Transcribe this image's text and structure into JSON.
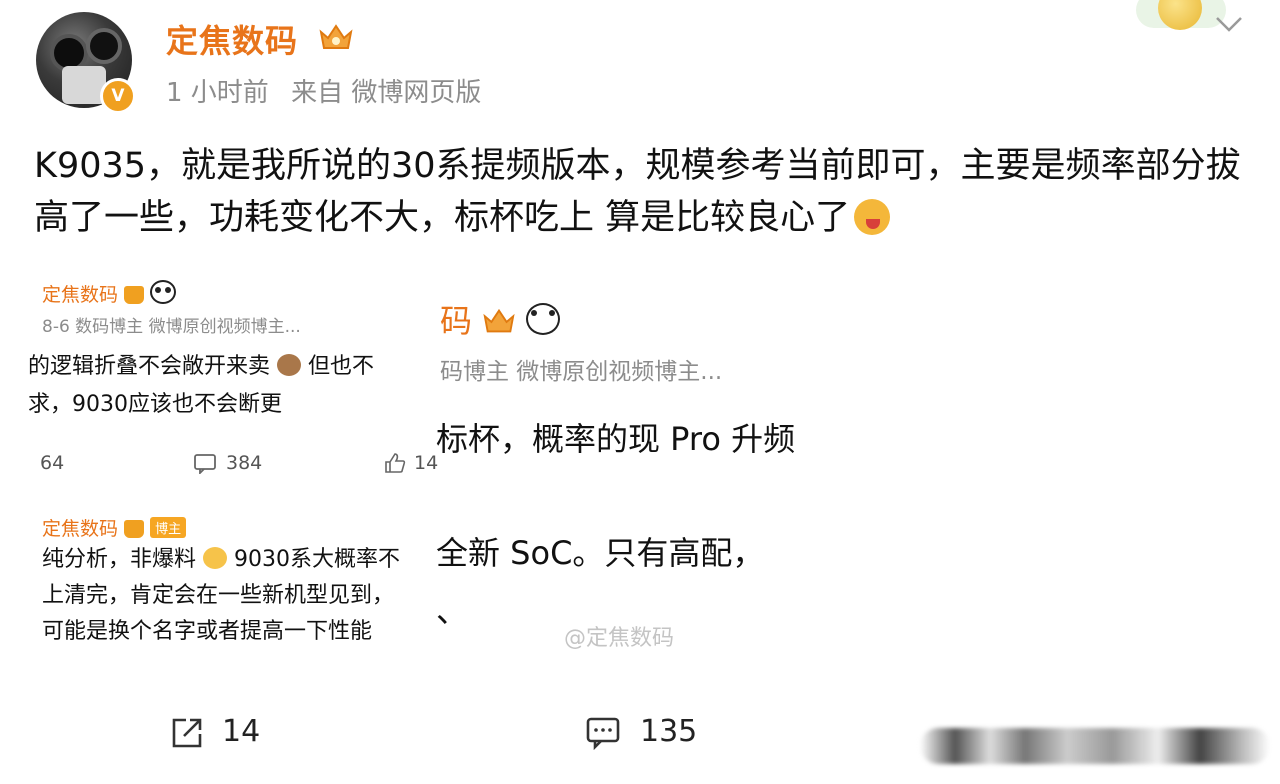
{
  "author": {
    "name": "定焦数码",
    "verified_label": "V",
    "time": "1 小时前",
    "source": "来自 微博网页版"
  },
  "post": {
    "text": "K9035，就是我所说的30系提频版本，规模参考当前即可，主要是频率部分拔高了一些，功耗变化不大，标杯吃上 算是比较良心了"
  },
  "embedded_left_top": {
    "username": "定焦数码",
    "sub": "8-6  数码博主  微博原创视频博主...",
    "line1": "的逻辑折叠不会敞开来卖",
    "line1_tail": "但也不",
    "line2": "求，9030应该也不会断更",
    "stat_a": "64",
    "stat_b": "384",
    "stat_c": "14"
  },
  "embedded_left_bottom": {
    "username": "定焦数码",
    "badge": "博主",
    "line1_a": "纯分析，非爆料",
    "line1_b": "9030系大概率不",
    "line2": "上清完，肯定会在一些新机型见到，",
    "line3": "可能是换个名字或者提高一下性能"
  },
  "embedded_right": {
    "username": "码",
    "sub": "码博主  微博原创视频博主...",
    "line1": "标杯，概率的现 Pro 升频",
    "line2": "全新 SoC。只有高配，",
    "frag": "、"
  },
  "watermark": "@定焦数码",
  "footer": {
    "share_count": "14",
    "comment_count": "135"
  },
  "colors": {
    "accent_orange": "#e8741a",
    "meta_gray": "#8c8c8c"
  }
}
